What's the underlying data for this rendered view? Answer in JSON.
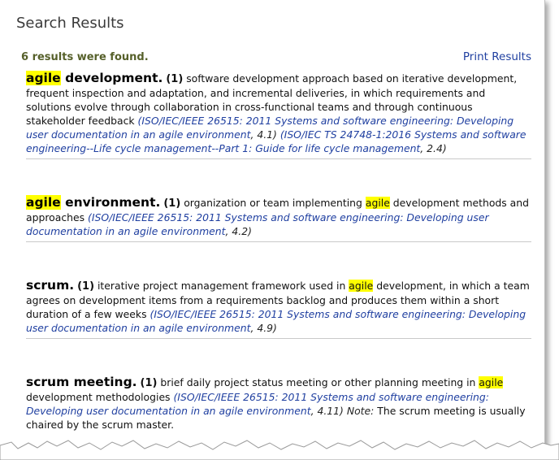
{
  "header": {
    "title": "Search Results",
    "count_text": "6 results were found.",
    "print_label": "Print Results"
  },
  "results": [
    {
      "term_hl": "agile",
      "term_rest": " development.",
      "sense": "(1)",
      "definition": " software development approach based on iterative development, frequent inspection and adaptation, and incremental deliveries, in which requirements and solutions evolve through collaboration in cross-functional teams and through continuous stakeholder feedback ",
      "source1": "(ISO/IEC/IEEE 26515: 2011 Systems and software engineering: Developing user documentation in an agile environment",
      "ref1": ", 4.1) ",
      "source2": "(ISO/IEC TS 24748-1:2016 Systems and software engineering--Life cycle management--Part 1: Guide for life cycle management",
      "ref2": ", 2.4)"
    },
    {
      "term_hl": "agile",
      "term_rest": " environment.",
      "sense": "(1)",
      "def_a": " organization or team implementing ",
      "def_hl": "agile",
      "def_b": " development methods and approaches ",
      "source1": "(ISO/IEC/IEEE 26515: 2011 Systems and software engineering: Developing user documentation in an agile environment",
      "ref1": ", 4.2)"
    },
    {
      "term": "scrum.",
      "sense": "(1)",
      "def_a": " iterative project management framework used in ",
      "def_hl": "agile",
      "def_b": " development, in which a team agrees on development items from a requirements backlog and produces them within a short duration of a few weeks ",
      "source1": "(ISO/IEC/IEEE 26515: 2011 Systems and software engineering: Developing user documentation in an agile environment",
      "ref1": ", 4.9)"
    },
    {
      "term": "scrum meeting.",
      "sense": "(1)",
      "def_a": " brief daily project status meeting or other planning meeting in ",
      "def_hl": "agile",
      "def_b": " development methodologies ",
      "source1": "(ISO/IEC/IEEE 26515: 2011 Systems and software engineering: Developing user documentation in an agile environment",
      "ref1": ", 4.11) ",
      "note_label": "Note:",
      "note_text": " The scrum meeting is usually chaired by the scrum master."
    }
  ],
  "colors": {
    "highlight": "#ffff00",
    "link": "#1f3fa0",
    "count": "#56602a"
  }
}
